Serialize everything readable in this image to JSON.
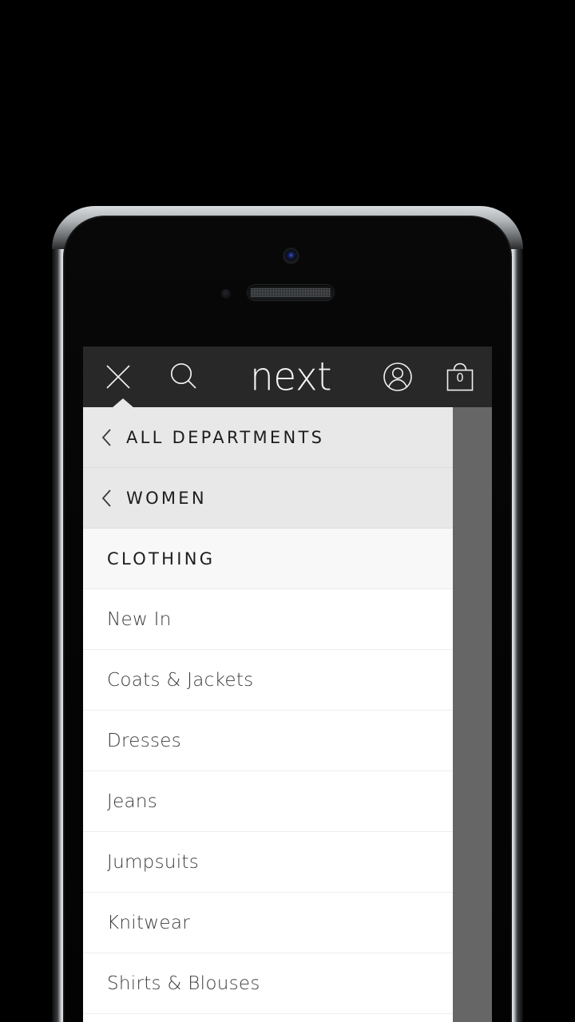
{
  "device": {
    "name": "smartphone-mockup",
    "hardware": {
      "power_button": "power-button",
      "mute_switch": "mute-switch",
      "volume_up": "volume-up-button",
      "volume_down": "volume-down-button",
      "camera": "front-camera",
      "earpiece": "earpiece-speaker",
      "sensor": "proximity-sensor"
    }
  },
  "appbar": {
    "background": "#282828",
    "close_icon": "close-icon",
    "search_icon": "search-icon",
    "logo": "next",
    "account_icon": "account-icon",
    "bag_icon": "shopping-bag-icon",
    "bag_count": "0"
  },
  "drawer": {
    "nav": [
      {
        "label": "ALL DEPARTMENTS",
        "icon": "chevron-left-icon"
      },
      {
        "label": "WOMEN",
        "icon": "chevron-left-icon"
      }
    ],
    "section_title": "CLOTHING",
    "items": [
      {
        "label": "New In"
      },
      {
        "label": "Coats & Jackets"
      },
      {
        "label": "Dresses"
      },
      {
        "label": "Jeans"
      },
      {
        "label": "Jumpsuits"
      },
      {
        "label": "Knitwear"
      },
      {
        "label": "Shirts & Blouses"
      }
    ]
  },
  "colors": {
    "appbar_bg": "#282828",
    "nav_row_bg": "#e8e8e8",
    "section_bg": "#f8f8f8",
    "item_bg": "#ffffff",
    "overlay_dim": "#666666",
    "text_dark": "#1d1d1d",
    "text_item": "#3b3b3b"
  }
}
